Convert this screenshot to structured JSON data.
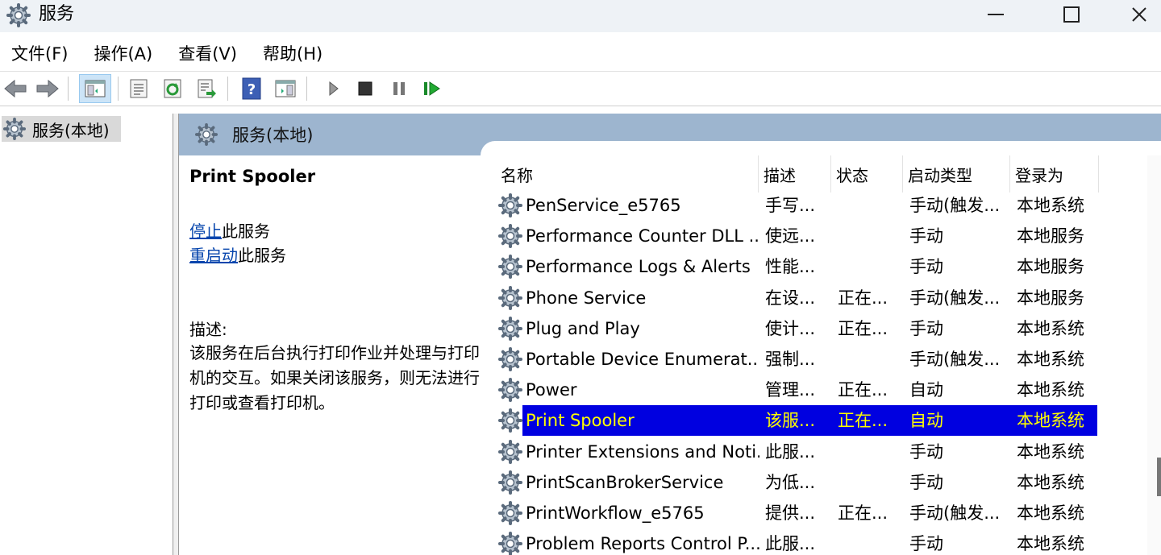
{
  "window": {
    "title": "服务"
  },
  "menu": [
    {
      "label": "文件(F)"
    },
    {
      "label": "操作(A)"
    },
    {
      "label": "查看(V)"
    },
    {
      "label": "帮助(H)"
    }
  ],
  "tree": {
    "root_label": "服务(本地)"
  },
  "pane": {
    "header_title": "服务(本地)"
  },
  "detail": {
    "service_name": "Print Spooler",
    "stop_link": "停止",
    "stop_suffix": "此服务",
    "restart_link": "重启动",
    "restart_suffix": "此服务",
    "desc_label": "描述:",
    "desc_text": "该服务在后台执行打印作业并处理与打印机的交互。如果关闭该服务，则无法进行打印或查看打印机。"
  },
  "list": {
    "columns": {
      "name": "名称",
      "desc": "描述",
      "status": "状态",
      "startup": "启动类型",
      "logon": "登录为"
    },
    "sort_indicator": "^",
    "rows": [
      {
        "name": "PenService_e5765",
        "desc": "手写...",
        "status": "",
        "startup": "手动(触发...",
        "logon": "本地系统"
      },
      {
        "name": "Performance Counter DLL ...",
        "desc": "使远...",
        "status": "",
        "startup": "手动",
        "logon": "本地服务"
      },
      {
        "name": "Performance Logs & Alerts",
        "desc": "性能...",
        "status": "",
        "startup": "手动",
        "logon": "本地服务"
      },
      {
        "name": "Phone Service",
        "desc": "在设...",
        "status": "正在...",
        "startup": "手动(触发...",
        "logon": "本地服务"
      },
      {
        "name": "Plug and Play",
        "desc": "使计...",
        "status": "正在...",
        "startup": "手动",
        "logon": "本地系统"
      },
      {
        "name": "Portable Device Enumerat...",
        "desc": "强制...",
        "status": "",
        "startup": "手动(触发...",
        "logon": "本地系统"
      },
      {
        "name": "Power",
        "desc": "管理...",
        "status": "正在...",
        "startup": "自动",
        "logon": "本地系统"
      },
      {
        "name": "Print Spooler",
        "desc": "该服...",
        "status": "正在...",
        "startup": "自动",
        "logon": "本地系统",
        "selected": true
      },
      {
        "name": "Printer Extensions and Noti...",
        "desc": "此服...",
        "status": "",
        "startup": "手动",
        "logon": "本地系统"
      },
      {
        "name": "PrintScanBrokerService",
        "desc": "为低...",
        "status": "",
        "startup": "手动",
        "logon": "本地系统"
      },
      {
        "name": "PrintWorkflow_e5765",
        "desc": "提供...",
        "status": "正在...",
        "startup": "手动(触发...",
        "logon": "本地系统"
      },
      {
        "name": "Problem Reports Control P...",
        "desc": "此服...",
        "status": "",
        "startup": "手动",
        "logon": "本地系统"
      }
    ]
  },
  "toolbar": {
    "buttons": [
      "back-icon",
      "forward-icon",
      "show-hide-console-tree-icon",
      "properties-icon",
      "refresh-icon",
      "export-list-icon",
      "help-icon",
      "action-pane-icon",
      "start-service-icon",
      "stop-service-icon",
      "pause-service-icon",
      "resume-service-icon"
    ]
  },
  "colors": {
    "selection_bg": "#0000e0",
    "selection_text": "#ffff00",
    "pane_header": "#9db5cf",
    "link": "#0645ad"
  }
}
